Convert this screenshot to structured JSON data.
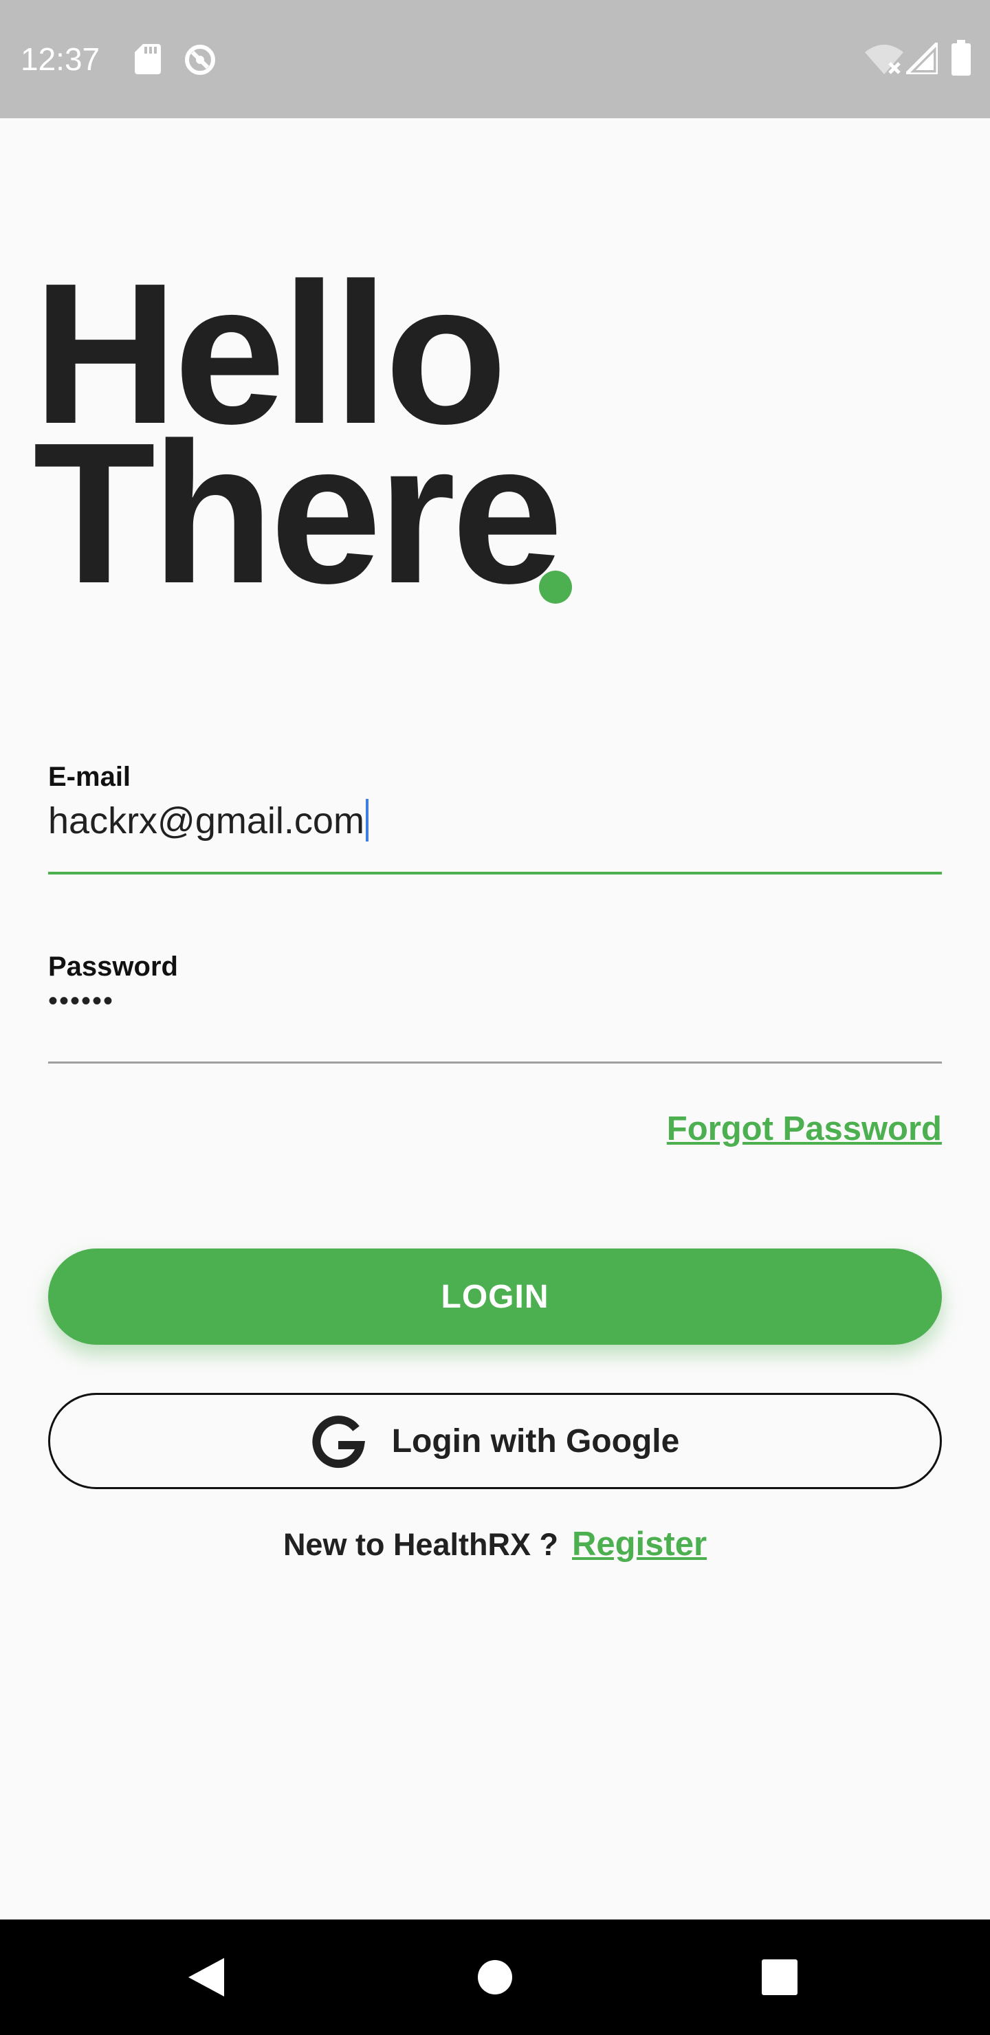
{
  "status_bar": {
    "time": "12:37",
    "icons": [
      "sd-card-icon",
      "sync-icon",
      "wifi-off-icon",
      "signal-icon",
      "battery-icon"
    ]
  },
  "heading": {
    "line1": "Hello",
    "line2": "There",
    "accent_dot_color": "#4caf50"
  },
  "email": {
    "label": "E-mail",
    "value": "hackrx@gmail.com"
  },
  "password": {
    "label": "Password",
    "value": "••••••"
  },
  "forgot_password": "Forgot Password",
  "login_button": "LOGIN",
  "google_button": "Login with Google",
  "register": {
    "prompt": "New to HealthRX ?",
    "link": "Register"
  },
  "colors": {
    "accent": "#4caf50",
    "text": "#212121",
    "background": "#fafafa",
    "status_bar": "#bdbdbd",
    "nav_bar": "#000000"
  },
  "nav_bar": {
    "buttons": [
      "back-icon",
      "home-icon",
      "recents-icon"
    ]
  }
}
